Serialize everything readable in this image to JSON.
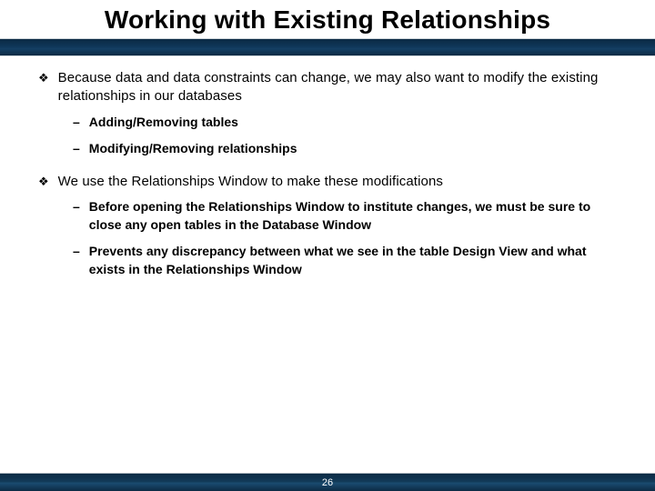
{
  "title": "Working with Existing Relationships",
  "bullets": [
    {
      "text": "Because data and data constraints can change, we may also want to modify the existing relationships in our databases",
      "subs": [
        "Adding/Removing tables",
        "Modifying/Removing relationships"
      ]
    },
    {
      "text": "We use the Relationships Window to make these modifications",
      "subs": [
        "Before opening the Relationships Window to institute changes, we must be sure to close any open tables in the Database Window",
        "Prevents any discrepancy between what we see in the table Design View and what exists in the Relationships Window"
      ]
    }
  ],
  "pageNumber": "26"
}
